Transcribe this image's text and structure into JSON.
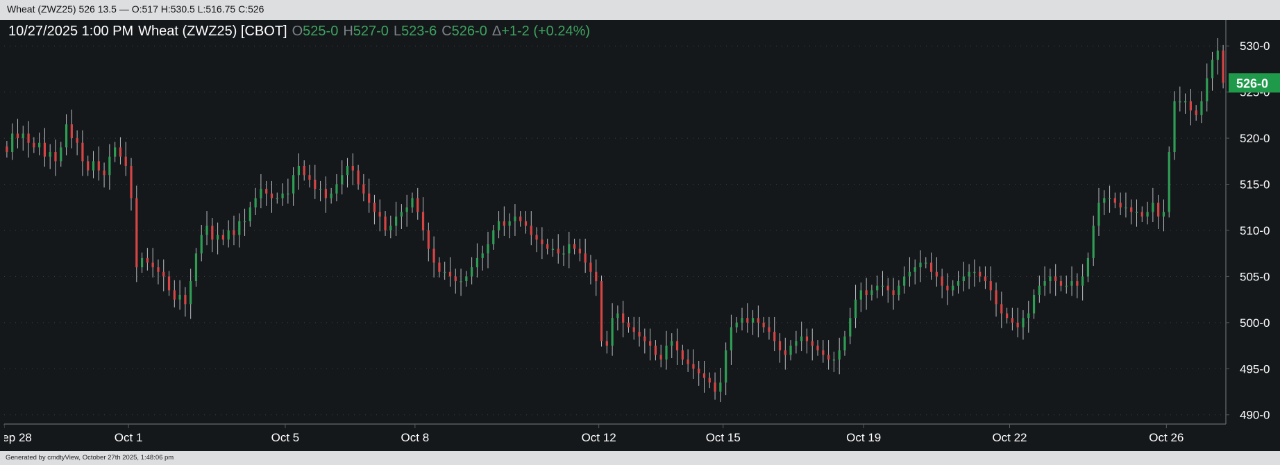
{
  "window": {
    "title": "Wheat (ZWZ25) 526 13.5 — O:517 H:530.5 L:516.75 C:526"
  },
  "legend": {
    "datetime": "10/27/2025  1:00 PM",
    "instrument": "Wheat (ZWZ25) [CBOT]",
    "open_label": "O",
    "open_value": "525-0",
    "high_label": "H",
    "high_value": "527-0",
    "low_label": "L",
    "low_value": "523-6",
    "close_label": "C",
    "close_value": "526-0",
    "change_label": "Δ",
    "change_value": "+1-2 (+0.24%)"
  },
  "footer": {
    "text": "Generated by cmdtyView, October 27th 2025, 1:48:06 pm"
  },
  "colors": {
    "background": "#15181b",
    "up": "#2f9e54",
    "down": "#d64545",
    "wick": "#b9bdc1",
    "grid": "#3b4045",
    "axis_text": "#ffffff",
    "price_badge": "#1f9a4b"
  },
  "chart_data": {
    "type": "candlestick",
    "title": "",
    "xlabel": "",
    "ylabel": "",
    "ylim": [
      489,
      532.5
    ],
    "y_ticks": [
      {
        "value": 490,
        "label": "490-0"
      },
      {
        "value": 495,
        "label": "495-0"
      },
      {
        "value": 500,
        "label": "500-0"
      },
      {
        "value": 505,
        "label": "505-0"
      },
      {
        "value": 510,
        "label": "510-0"
      },
      {
        "value": 515,
        "label": "515-0"
      },
      {
        "value": 520,
        "label": "520-0"
      },
      {
        "value": 525,
        "label": "525-0"
      },
      {
        "value": 530,
        "label": "530-0"
      }
    ],
    "x_ticks": [
      {
        "index": 0,
        "label": "Sep 28"
      },
      {
        "index": 1,
        "label": "Oct 1"
      },
      {
        "index": 2,
        "label": "Oct 5"
      },
      {
        "index": 3,
        "label": "Oct 8"
      },
      {
        "index": 4,
        "label": "Oct 12"
      },
      {
        "index": 5,
        "label": "Oct 15"
      },
      {
        "index": 6,
        "label": "Oct 19"
      },
      {
        "index": 7,
        "label": "Oct 22"
      },
      {
        "index": 8,
        "label": "Oct 26"
      }
    ],
    "grid": true,
    "last_price": {
      "value": 526,
      "label": "526-0"
    },
    "series": [
      {
        "session": "Sep 28",
        "close": [
          518.5,
          520.5,
          520.0,
          520.5,
          519.5,
          519.0,
          519.5,
          518.0,
          518.5,
          517.5,
          519.0,
          521.5,
          520.0,
          519.5,
          517.5,
          516.5,
          517.5,
          516.5,
          516.0,
          518.0,
          519.0,
          518.0,
          517.0
        ]
      },
      {
        "session": "Oct 1",
        "close": [
          513.5,
          506.0,
          507.0,
          506.5,
          506.0,
          505.5,
          505.0,
          503.5,
          502.5,
          503.0,
          502.0,
          504.5,
          507.5,
          509.5,
          510.5,
          509.0,
          509.5,
          509.0,
          510.0,
          509.5,
          511.0,
          511.0,
          512.5,
          513.5,
          514.5,
          514.0,
          513.5,
          513.5,
          514.0
        ]
      },
      {
        "session": "Oct 5",
        "close": [
          514.0,
          516.0,
          517.0,
          516.0,
          515.5,
          514.5,
          514.5,
          513.5,
          514.0,
          515.0,
          516.0,
          517.0,
          516.5,
          515.0,
          514.0,
          513.0,
          512.0,
          511.5,
          510.0,
          510.5,
          511.5,
          512.0,
          512.5,
          513.5
        ]
      },
      {
        "session": "Oct 8",
        "close": [
          512.0,
          510.0,
          508.0,
          506.5,
          505.5,
          505.5,
          505.0,
          504.5,
          504.5,
          505.0,
          506.0,
          507.0,
          507.5,
          508.5,
          510.0,
          511.0,
          510.5,
          511.0,
          511.5,
          511.0,
          510.5,
          509.5,
          509.0,
          508.5,
          508.0,
          508.0,
          507.5,
          507.5,
          508.5,
          508.0,
          507.5,
          506.5,
          505.5,
          504.5
        ]
      },
      {
        "session": "Oct 12",
        "close": [
          498.0,
          497.5,
          500.5,
          501.0,
          500.0,
          499.5,
          499.0,
          498.5,
          498.0,
          497.5,
          496.5,
          496.0,
          497.5,
          498.0,
          497.0,
          496.0,
          495.5,
          495.0,
          494.5,
          494.0,
          493.5,
          492.5,
          493.5
        ]
      },
      {
        "session": "Oct 15",
        "close": [
          497.0,
          499.5,
          500.0,
          500.5,
          500.0,
          500.5,
          500.0,
          499.5,
          499.0,
          498.0,
          497.0,
          496.5,
          497.5,
          498.0,
          498.5,
          498.0,
          497.5,
          497.0,
          496.5,
          496.0,
          496.0,
          497.0,
          498.5,
          500.5,
          502.5,
          503.5
        ]
      },
      {
        "session": "Oct 19",
        "close": [
          503.0,
          503.5,
          504.0,
          504.0,
          503.5,
          503.0,
          504.0,
          505.0,
          505.5,
          506.0,
          506.5,
          506.5,
          505.5,
          505.0,
          504.0,
          503.5,
          504.0,
          504.5,
          505.0,
          505.5,
          505.5,
          505.0,
          504.5,
          503.5,
          502.0,
          501.0,
          500.5
        ]
      },
      {
        "session": "Oct 22",
        "close": [
          500.0,
          499.5,
          500.5,
          501.0,
          503.0,
          504.0,
          504.5,
          505.0,
          504.5,
          504.0,
          504.0,
          504.5,
          504.0,
          505.0,
          507.0,
          510.5,
          513.0,
          513.5,
          513.5,
          513.0,
          512.5,
          512.5,
          512.0,
          512.0,
          511.5,
          512.0,
          513.0,
          511.5,
          512.0
        ]
      },
      {
        "session": "Oct 26",
        "close": [
          518.5,
          524.0,
          524.0,
          524.0,
          523.0,
          522.5,
          524.0,
          526.5,
          528.5,
          529.5,
          526.0
        ]
      }
    ]
  }
}
